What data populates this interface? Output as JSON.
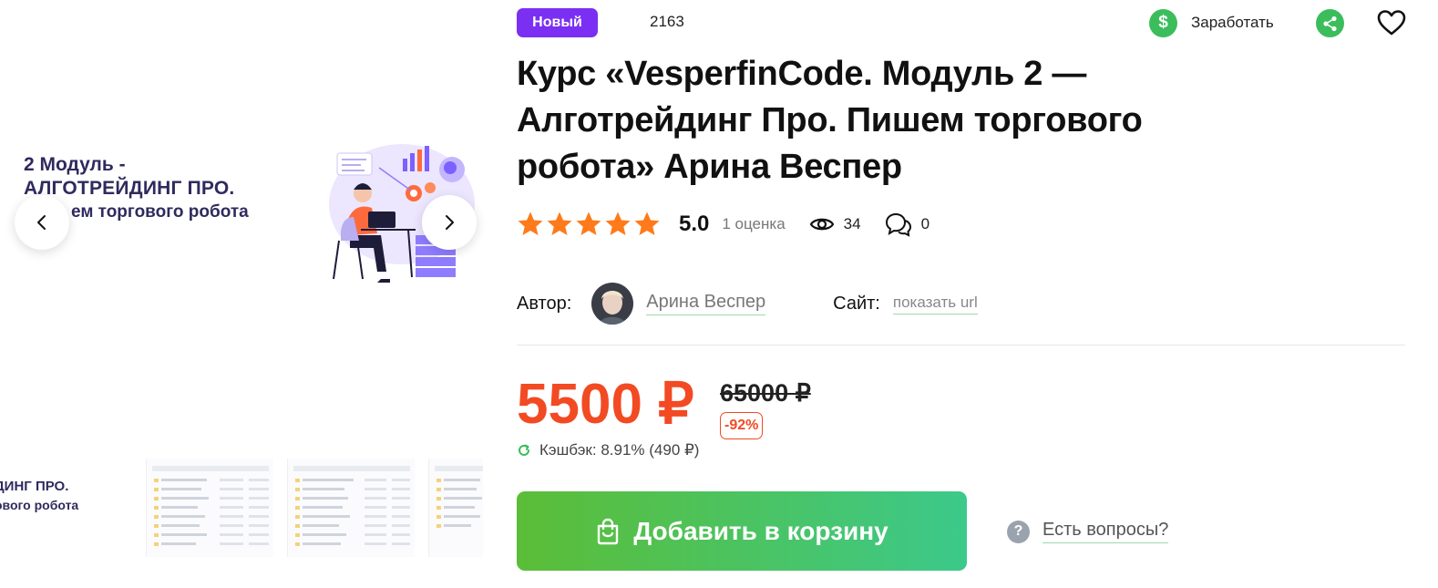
{
  "gallery": {
    "slide_line1": "2 Модуль -",
    "slide_line2": "АЛГОТРЕЙДИНГ ПРО.",
    "slide_line3": "ем торгового робота",
    "thumb_line1": "ДИНГ ПРО.",
    "thumb_line2": "ового робота",
    "prev_icon": "chevron-left-icon",
    "next_icon": "chevron-right-icon"
  },
  "header": {
    "badge": "Новый",
    "item_id": "2163",
    "earn_symbol": "$",
    "earn_label": "Заработать",
    "share_icon": "share-icon",
    "favorite_icon": "heart-icon"
  },
  "product": {
    "title": "Курс «VesperfinCode. Модуль 2 — Алготрейдинг Про. Пишем торгового робота» Арина Веспер"
  },
  "rating": {
    "stars": 5,
    "value": "5.0",
    "count_label": "1 оценка",
    "views": "34",
    "comments": "0",
    "star_color": "#ff7a1a"
  },
  "meta": {
    "author_label": "Автор:",
    "author_name": "Арина Веспер",
    "site_label": "Сайт:",
    "site_link": "показать url"
  },
  "pricing": {
    "price": "5500 ₽",
    "old_price": "65000 ₽",
    "discount": "-92%",
    "cashback": "Кэшбэк: 8.91% (490 ₽)",
    "price_color": "#f24a23"
  },
  "actions": {
    "add_to_cart": "Добавить в корзину",
    "questions_symbol": "?",
    "questions": "Есть вопросы?"
  }
}
